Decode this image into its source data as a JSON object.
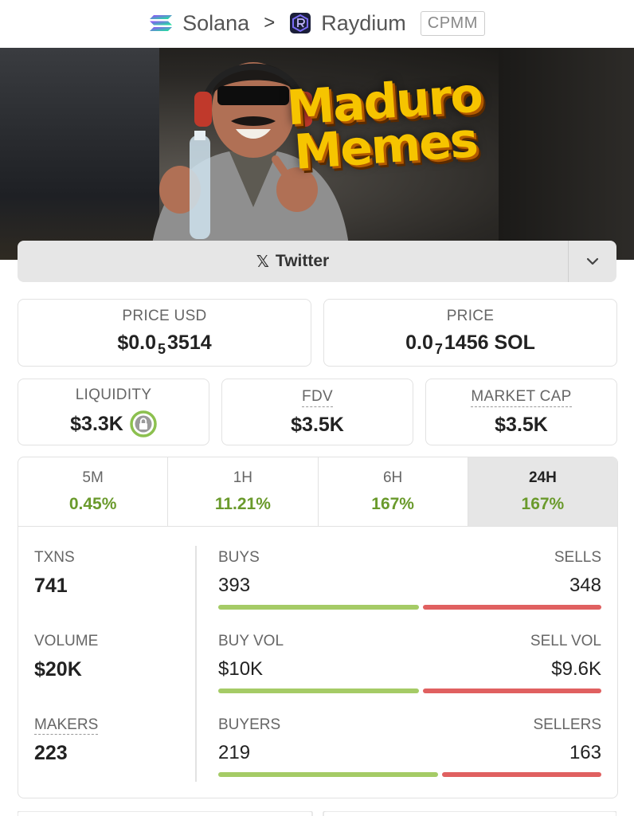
{
  "breadcrumb": {
    "chain": "Solana",
    "separator": ">",
    "dex": "Raydium",
    "pool_type": "CPMM"
  },
  "banner": {
    "title_line1": "Maduro",
    "title_line2": "Memes"
  },
  "social": {
    "twitter_label": "Twitter",
    "x_glyph": "𝕏",
    "chevron_icon": "chevron-down-icon"
  },
  "price": {
    "usd_label": "PRICE USD",
    "usd_prefix": "$0.0",
    "usd_sub": "5",
    "usd_digits": "3514",
    "native_label": "PRICE",
    "native_prefix": "0.0",
    "native_sub": "7",
    "native_digits": "1456 SOL"
  },
  "metrics": {
    "liquidity_label": "LIQUIDITY",
    "liquidity_value": "$3.3K",
    "fdv_label": "FDV",
    "fdv_value": "$3.5K",
    "mcap_label": "MARKET CAP",
    "mcap_value": "$3.5K"
  },
  "timeframes": [
    {
      "label": "5M",
      "change": "0.45%"
    },
    {
      "label": "1H",
      "change": "11.21%"
    },
    {
      "label": "6H",
      "change": "167%"
    },
    {
      "label": "24H",
      "change": "167%"
    }
  ],
  "active_timeframe": "24H",
  "txns": {
    "label": "TXNS",
    "value": "741",
    "buys_label": "BUYS",
    "buys": "393",
    "sells_label": "SELLS",
    "sells": "348",
    "buy_share": 0.53
  },
  "volume": {
    "label": "VOLUME",
    "value": "$20K",
    "buy_label": "BUY VOL",
    "buy": "$10K",
    "sell_label": "SELL VOL",
    "sell": "$9.6K",
    "buy_share": 0.53
  },
  "makers": {
    "label": "MAKERS",
    "value": "223",
    "buyers_label": "BUYERS",
    "buyers": "219",
    "sellers_label": "SELLERS",
    "sellers": "163",
    "buy_share": 0.58
  },
  "colors": {
    "positive": "#6a9a2c",
    "buy_bar": "#a5cb66",
    "sell_bar": "#e06060",
    "banner_title": "#f6c400"
  }
}
